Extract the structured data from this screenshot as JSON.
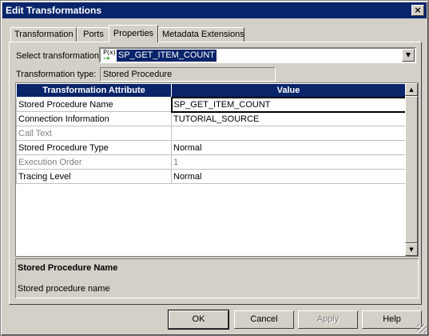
{
  "window": {
    "title": "Edit Transformations",
    "close_glyph": "×"
  },
  "tabs": [
    {
      "label": "Transformation"
    },
    {
      "label": "Ports"
    },
    {
      "label": "Properties"
    },
    {
      "label": "Metadata Extensions"
    }
  ],
  "active_tab": "Properties",
  "select_transformation": {
    "label": "Select transformation:",
    "icon_text": "P(x)",
    "value": "SP_GET_ITEM_COUNT"
  },
  "transformation_type": {
    "label": "Transformation type:",
    "value": "Stored Procedure"
  },
  "grid": {
    "headers": [
      "Transformation Attribute",
      "Value"
    ],
    "rows": [
      {
        "attribute": "Stored Procedure Name",
        "value": "SP_GET_ITEM_COUNT",
        "enabled": true,
        "editing": true
      },
      {
        "attribute": "Connection Information",
        "value": "TUTORIAL_SOURCE",
        "enabled": true
      },
      {
        "attribute": "Call Text",
        "value": "",
        "enabled": false
      },
      {
        "attribute": "Stored Procedure Type",
        "value": "Normal",
        "enabled": true
      },
      {
        "attribute": "Execution Order",
        "value": "1",
        "enabled": false
      },
      {
        "attribute": "Tracing Level",
        "value": "Normal",
        "enabled": true
      }
    ]
  },
  "description": {
    "title": "Stored Procedure Name",
    "text": "Stored procedure name"
  },
  "buttons": {
    "ok": "OK",
    "cancel": "Cancel",
    "apply": "Apply",
    "help": "Help"
  },
  "colors": {
    "titlebar": "#08246b",
    "selection": "#0a246a",
    "face": "#d4d0c8"
  }
}
